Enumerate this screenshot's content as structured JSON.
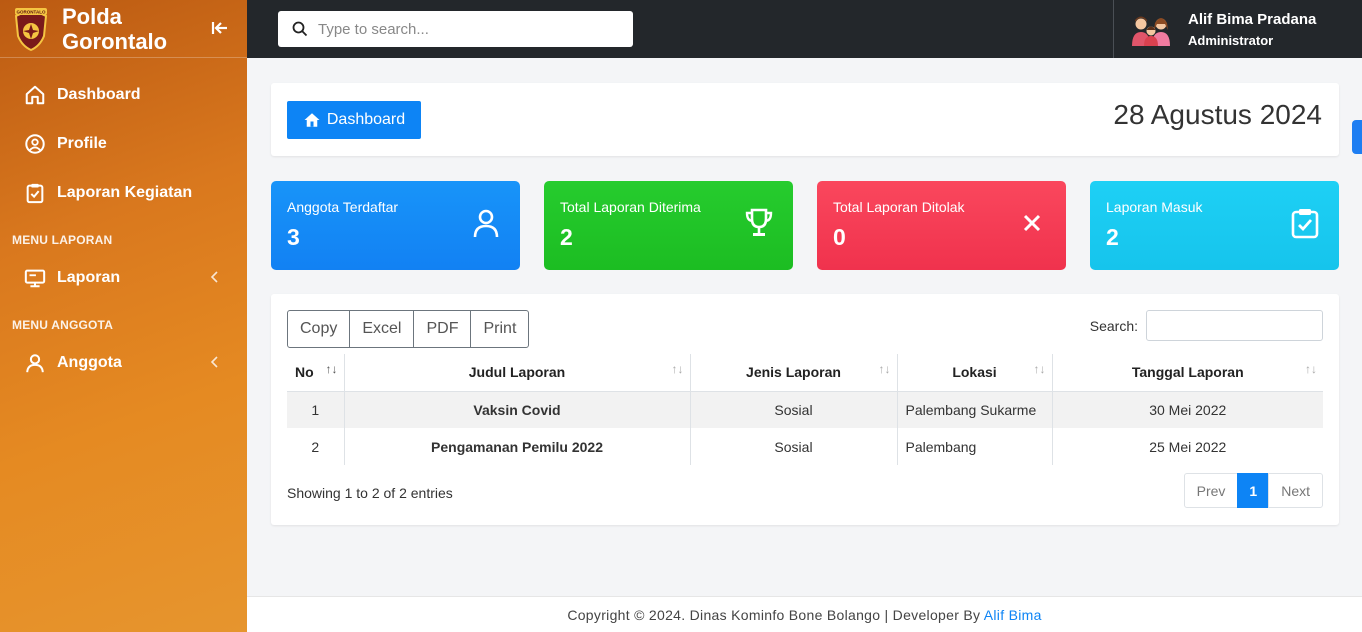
{
  "brand": {
    "line1": "Polda",
    "line2": "Gorontalo",
    "logo_text": "GORONTALO"
  },
  "sidebar": {
    "items": [
      {
        "label": "Dashboard",
        "icon": "home-icon"
      },
      {
        "label": "Profile",
        "icon": "user-circle-icon"
      },
      {
        "label": "Laporan Kegiatan",
        "icon": "clipboard-check-icon"
      }
    ],
    "section_laporan": "MENU LAPORAN",
    "laporan_label": "Laporan",
    "section_anggota": "MENU ANGGOTA",
    "anggota_label": "Anggota"
  },
  "topbar": {
    "search_placeholder": "Type to search...",
    "user_name": "Alif Bima Pradana",
    "user_role": "Administrator"
  },
  "header": {
    "button_label": "Dashboard",
    "date": "28 Agustus 2024"
  },
  "stats": [
    {
      "label": "Anggota Terdaftar",
      "value": "3",
      "color": "#1281f3",
      "icon": "user-icon"
    },
    {
      "label": "Total Laporan Diterima",
      "value": "2",
      "color": "#1cbd22",
      "icon": "trophy-icon"
    },
    {
      "label": "Total Laporan Ditolak",
      "value": "0",
      "color": "#f0324d",
      "icon": "x-icon"
    },
    {
      "label": "Laporan Masuk",
      "value": "2",
      "color": "#16c4ec",
      "icon": "clipboard-check-icon"
    }
  ],
  "table": {
    "export_buttons": [
      "Copy",
      "Excel",
      "PDF",
      "Print"
    ],
    "search_label": "Search:",
    "columns": [
      "No",
      "Judul Laporan",
      "Jenis Laporan",
      "Lokasi",
      "Tanggal Laporan"
    ],
    "rows": [
      [
        "1",
        "Vaksin Covid",
        "Sosial",
        "Palembang Sukarme",
        "30 Mei 2022"
      ],
      [
        "2",
        "Pengamanan Pemilu 2022",
        "Sosial",
        "Palembang",
        "25 Mei 2022"
      ]
    ],
    "showing": "Showing 1 to 2 of 2 entries",
    "pager": {
      "prev": "Prev",
      "page": "1",
      "next": "Next"
    }
  },
  "footer": {
    "text": "Copyright © 2024. Dinas Kominfo Bone Bolango | Developer By",
    "link": "Alif Bima"
  },
  "colors": {
    "primary": "#0d84f5",
    "sidebar": "#e58a22",
    "topbar": "#23272b"
  }
}
